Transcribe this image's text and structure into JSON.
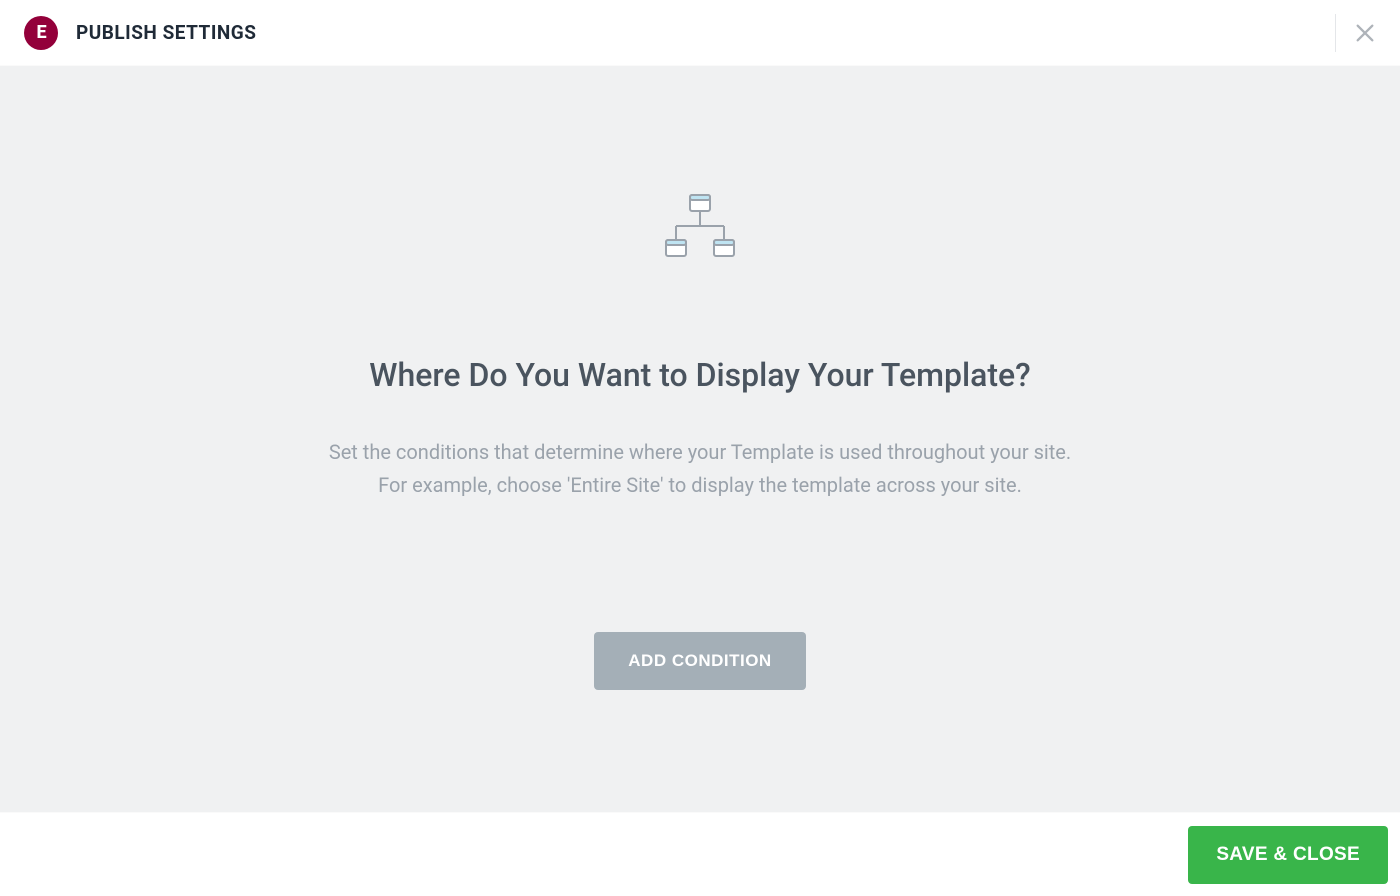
{
  "header": {
    "logo_letter": "E",
    "title": "PUBLISH SETTINGS"
  },
  "content": {
    "heading": "Where Do You Want to Display Your Template?",
    "description_line1": "Set the conditions that determine where your Template is used throughout your site.",
    "description_line2": "For example, choose 'Entire Site' to display the template across your site.",
    "add_condition_label": "ADD CONDITION"
  },
  "footer": {
    "save_label": "SAVE & CLOSE"
  },
  "icons": {
    "close": "close-icon",
    "hierarchy": "hierarchy-icon"
  },
  "colors": {
    "brand": "#93003a",
    "action_primary": "#39b54a",
    "button_muted": "#a4afb7",
    "canvas": "#f0f1f2"
  }
}
